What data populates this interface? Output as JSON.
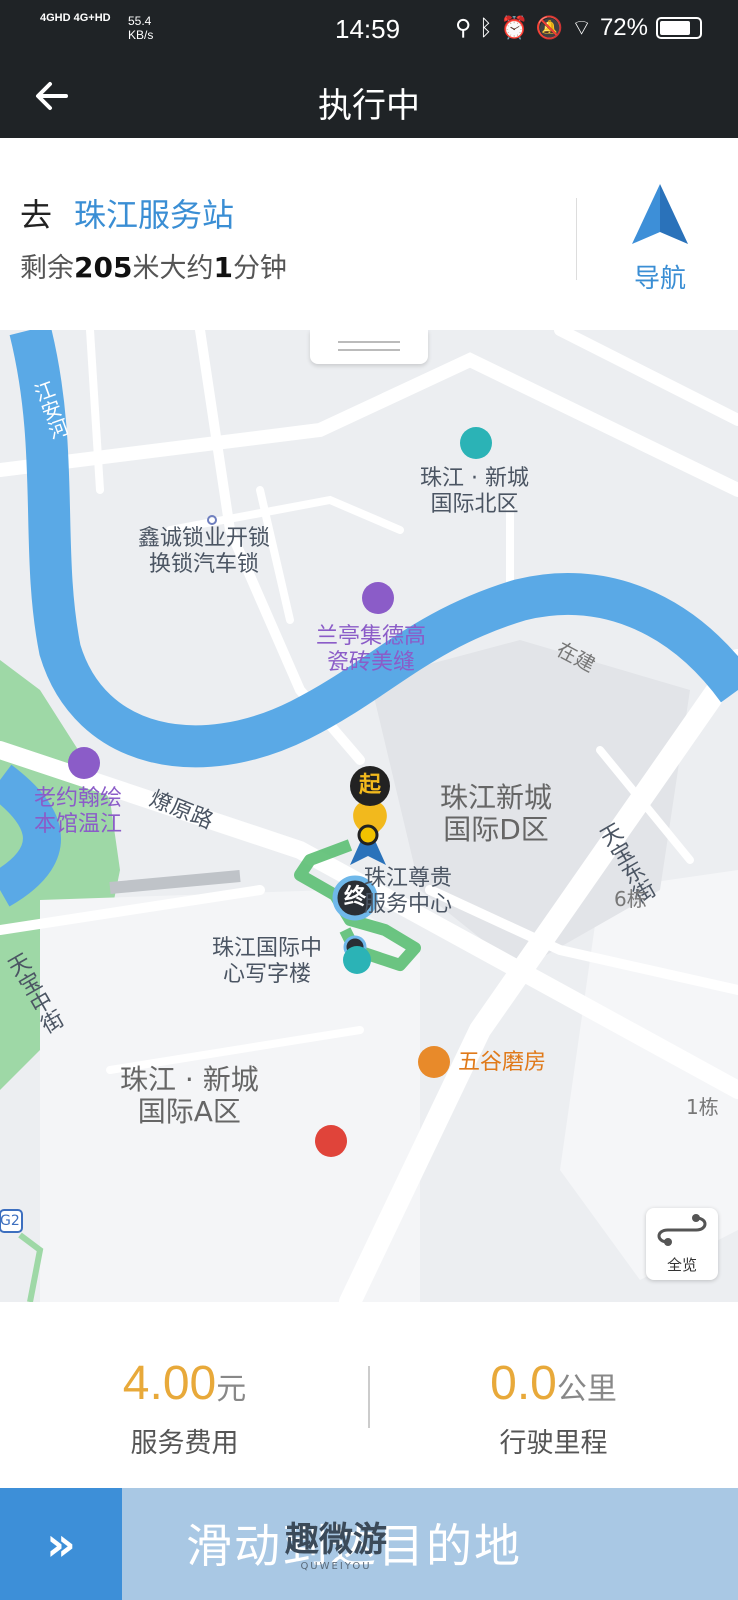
{
  "status": {
    "network": "4GHD 4G+HD",
    "speed": "55.4\nKB/s",
    "time": "14:59",
    "battery": "72%"
  },
  "header": {
    "title": "执行中",
    "back_icon": "arrow-left-icon"
  },
  "destination": {
    "prefix": "去",
    "name": "珠江服务站",
    "remain_prefix": "剩余",
    "remain_distance": "205",
    "remain_mid": "米大约",
    "remain_minutes": "1",
    "remain_suffix": "分钟",
    "nav_label": "导航"
  },
  "map": {
    "pois": {
      "river_name": "江安河",
      "north_area": "珠江 · 新城\n国际北区",
      "locksmith": "鑫诚锁业开锁\n换锁汽车锁",
      "tile_shop": "兰亭集德高\n瓷砖美缝",
      "old_house": "老约翰绘\n本馆温江",
      "road_liaoyuan": "燎原路",
      "area_d": "珠江新城\n国际D区",
      "service_center": "珠江尊贵\n服务中心",
      "office_tower": "珠江国际中\n心写字楼",
      "restaurant": "五谷磨房",
      "area_a": "珠江 · 新城\n国际A区",
      "under_construction": "在建",
      "street_tianbao_east": "天宝东街",
      "street_tianbao_mid": "天宝中街",
      "building_6": "6栋",
      "building_1": "1栋",
      "highway_badge": "G2"
    },
    "start_label": "起",
    "end_label": "终",
    "overview_label": "全览"
  },
  "stats": {
    "fee_value": "4.00",
    "fee_unit": "元",
    "fee_label": "服务费用",
    "distance_value": "0.0",
    "distance_unit": "公里",
    "distance_label": "行驶里程"
  },
  "slider": {
    "text": "滑动到达目的地",
    "watermark": "趣微游",
    "watermark_sub": "QUWEIYOU"
  },
  "colors": {
    "accent": "#3a8ed4",
    "value": "#e8a93a",
    "river": "#5aa9e6",
    "header": "#1f2326"
  }
}
